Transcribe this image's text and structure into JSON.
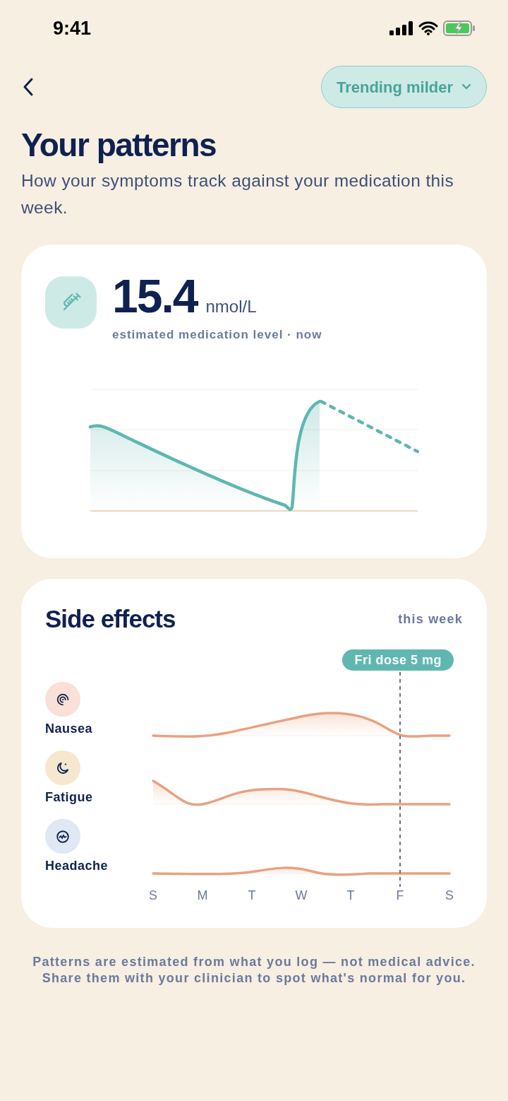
{
  "status_bar": {
    "time": "9:41"
  },
  "header": {
    "filter_label": "Trending milder"
  },
  "title": "Your patterns",
  "subtitle": "How your symptoms track against your medication this week.",
  "medication_card": {
    "value": "15.4",
    "unit": "nmol/L",
    "caption": "estimated medication level · now"
  },
  "side_effects": {
    "title": "Side effects",
    "period": "this week",
    "marker": "Fri dose 5 mg",
    "symptoms": [
      {
        "name": "Nausea",
        "kind": "nausea",
        "color": "#f9e1d7"
      },
      {
        "name": "Fatigue",
        "kind": "fatigue",
        "color": "#f6e8cf"
      },
      {
        "name": "Headache",
        "kind": "headache",
        "color": "#dfe8f3"
      }
    ],
    "days": [
      "S",
      "M",
      "T",
      "W",
      "T",
      "F",
      "S"
    ]
  },
  "footnote": "Patterns are estimated from what you log — not medical advice. Share them with your clinician to spot what's normal for you."
}
